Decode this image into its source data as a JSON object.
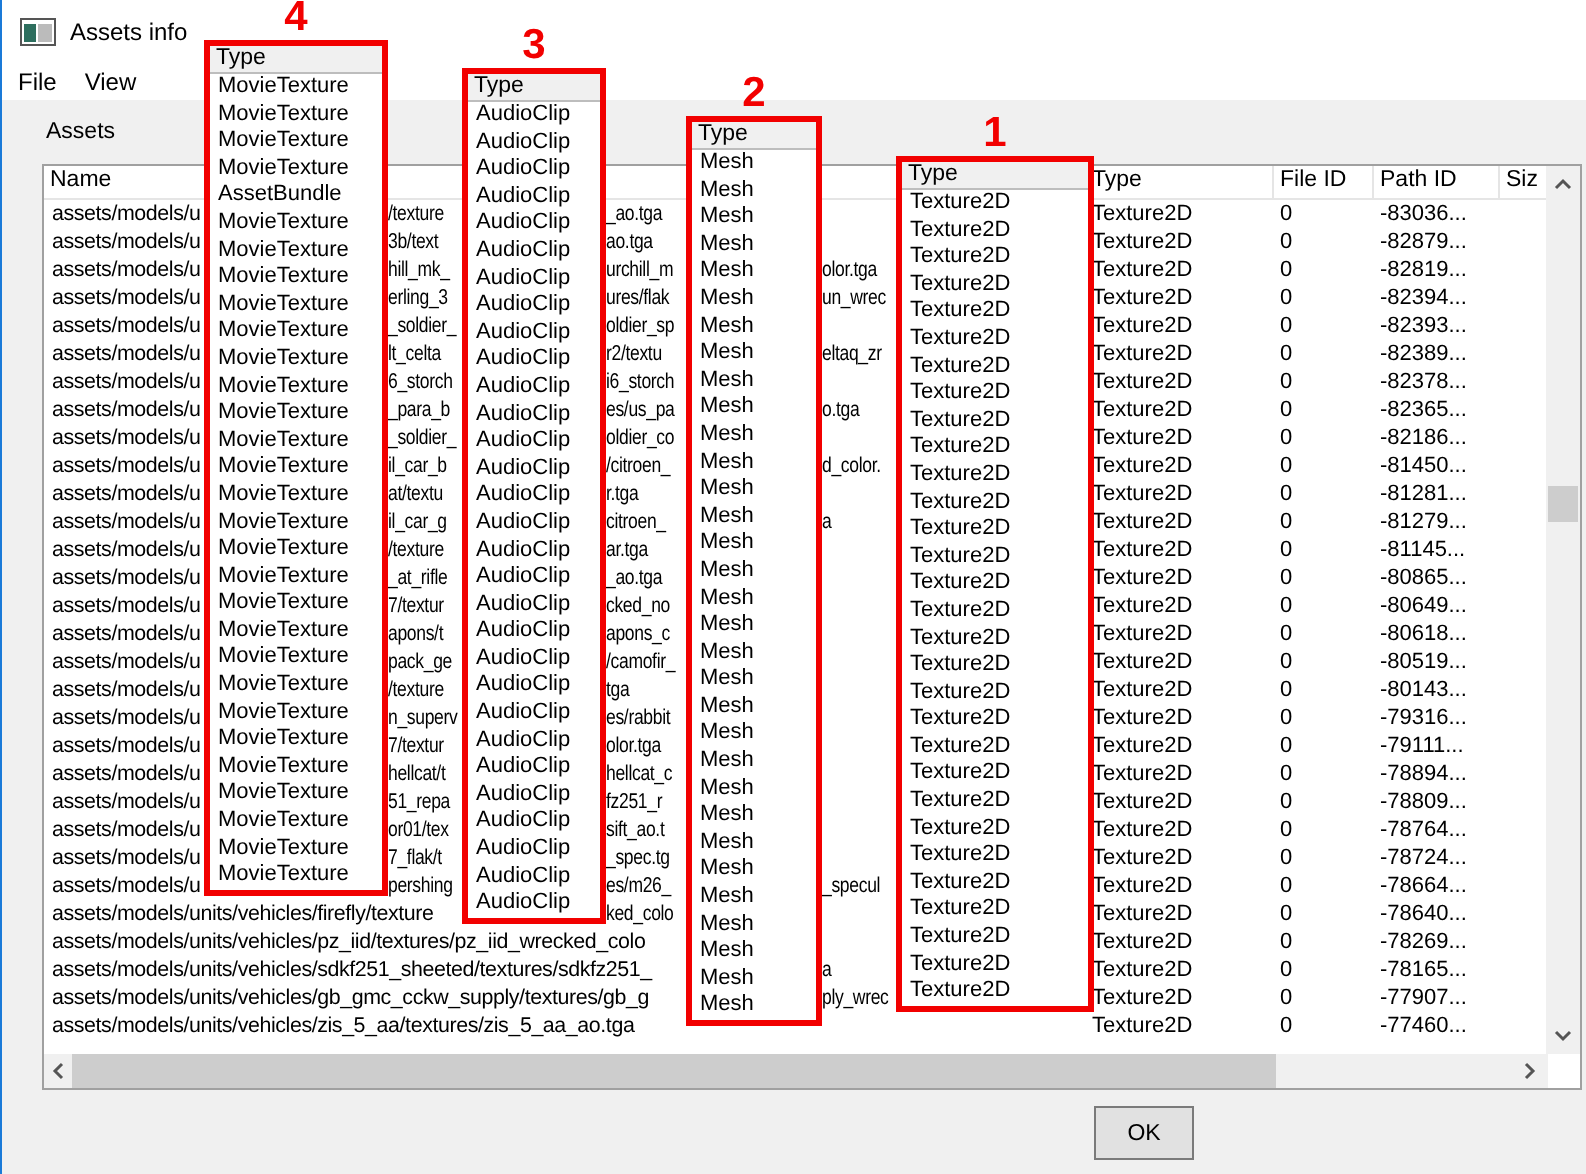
{
  "window": {
    "title": "Assets info"
  },
  "menu": [
    {
      "label": "File"
    },
    {
      "label": "View"
    }
  ],
  "group_label": "Assets",
  "table": {
    "columns": [
      "Name",
      "Type",
      "File ID",
      "Path ID",
      "Siz"
    ],
    "rows": [
      {
        "name": {
          "start": "assets/models/u",
          "gap_1": "/texture",
          "gap_2": "_ao.tga"
        },
        "type": "Texture2D",
        "file_id": "0",
        "path_id": "-83036..."
      },
      {
        "name": {
          "start": "assets/models/u",
          "gap_1": "3b/text",
          "gap_2": "ao.tga"
        },
        "type": "Texture2D",
        "file_id": "0",
        "path_id": "-82879..."
      },
      {
        "name": {
          "start": "assets/models/u",
          "gap_1": "hill_mk_",
          "gap_2": "urchill_m",
          "gap_3": "olor.tga"
        },
        "type": "Texture2D",
        "file_id": "0",
        "path_id": "-82819..."
      },
      {
        "name": {
          "start": "assets/models/u",
          "gap_1": "erling_3",
          "gap_2": "ures/flak",
          "gap_3": "un_wrec"
        },
        "type": "Texture2D",
        "file_id": "0",
        "path_id": "-82394..."
      },
      {
        "name": {
          "start": "assets/models/u",
          "gap_1": "_soldier_",
          "gap_2": "oldier_sp"
        },
        "type": "Texture2D",
        "file_id": "0",
        "path_id": "-82393..."
      },
      {
        "name": {
          "start": "assets/models/u",
          "gap_1": "lt_celta",
          "gap_2": "r2/textu",
          "gap_3": "eltaq_zr"
        },
        "type": "Texture2D",
        "file_id": "0",
        "path_id": "-82389..."
      },
      {
        "name": {
          "start": "assets/models/u",
          "gap_1": "6_storch",
          "gap_2": "i6_storch"
        },
        "type": "Texture2D",
        "file_id": "0",
        "path_id": "-82378..."
      },
      {
        "name": {
          "start": "assets/models/u",
          "gap_1": "_para_b",
          "gap_2": "es/us_pa",
          "gap_3": "o.tga"
        },
        "type": "Texture2D",
        "file_id": "0",
        "path_id": "-82365..."
      },
      {
        "name": {
          "start": "assets/models/u",
          "gap_1": "_soldier_",
          "gap_2": "oldier_co"
        },
        "type": "Texture2D",
        "file_id": "0",
        "path_id": "-82186..."
      },
      {
        "name": {
          "start": "assets/models/u",
          "gap_1": "il_car_b",
          "gap_2": "/citroen_",
          "gap_3": "d_color."
        },
        "type": "Texture2D",
        "file_id": "0",
        "path_id": "-81450..."
      },
      {
        "name": {
          "start": "assets/models/u",
          "gap_1": "at/textu",
          "gap_2": "r.tga"
        },
        "type": "Texture2D",
        "file_id": "0",
        "path_id": "-81281..."
      },
      {
        "name": {
          "start": "assets/models/u",
          "gap_1": "il_car_g",
          "gap_2": "citroen_",
          "gap_3": "a"
        },
        "type": "Texture2D",
        "file_id": "0",
        "path_id": "-81279..."
      },
      {
        "name": {
          "start": "assets/models/u",
          "gap_1": "/texture",
          "gap_2": "ar.tga"
        },
        "type": "Texture2D",
        "file_id": "0",
        "path_id": "-81145..."
      },
      {
        "name": {
          "start": "assets/models/u",
          "gap_1": "_at_rifle",
          "gap_2": "_ao.tga"
        },
        "type": "Texture2D",
        "file_id": "0",
        "path_id": "-80865..."
      },
      {
        "name": {
          "start": "assets/models/u",
          "gap_1": "7/textur",
          "gap_2": "cked_no"
        },
        "type": "Texture2D",
        "file_id": "0",
        "path_id": "-80649..."
      },
      {
        "name": {
          "start": "assets/models/u",
          "gap_1": "apons/t",
          "gap_2": "apons_c"
        },
        "type": "Texture2D",
        "file_id": "0",
        "path_id": "-80618..."
      },
      {
        "name": {
          "start": "assets/models/u",
          "gap_1": "pack_ge",
          "gap_2": "/camofir_"
        },
        "type": "Texture2D",
        "file_id": "0",
        "path_id": "-80519..."
      },
      {
        "name": {
          "start": "assets/models/u",
          "gap_1": "/texture",
          "gap_2": "tga"
        },
        "type": "Texture2D",
        "file_id": "0",
        "path_id": "-80143..."
      },
      {
        "name": {
          "start": "assets/models/u",
          "gap_1": "n_superv",
          "gap_2": "es/rabbit"
        },
        "type": "Texture2D",
        "file_id": "0",
        "path_id": "-79316..."
      },
      {
        "name": {
          "start": "assets/models/u",
          "gap_1": "7/textur",
          "gap_2": "olor.tga"
        },
        "type": "Texture2D",
        "file_id": "0",
        "path_id": "-79111..."
      },
      {
        "name": {
          "start": "assets/models/u",
          "gap_1": "hellcat/t",
          "gap_2": "hellcat_c"
        },
        "type": "Texture2D",
        "file_id": "0",
        "path_id": "-78894..."
      },
      {
        "name": {
          "start": "assets/models/u",
          "gap_1": "51_repa",
          "gap_2": "fz251_r"
        },
        "type": "Texture2D",
        "file_id": "0",
        "path_id": "-78809..."
      },
      {
        "name": {
          "start": "assets/models/u",
          "gap_1": "or01/tex",
          "gap_2": "sift_ao.t"
        },
        "type": "Texture2D",
        "file_id": "0",
        "path_id": "-78764..."
      },
      {
        "name": {
          "start": "assets/models/u",
          "gap_1": "7_flak/t",
          "gap_2": "_spec.tg"
        },
        "type": "Texture2D",
        "file_id": "0",
        "path_id": "-78724..."
      },
      {
        "name": {
          "start": "assets/models/u",
          "gap_1": "pershing",
          "gap_2": "es/m26_",
          "gap_3": "_specul"
        },
        "type": "Texture2D",
        "file_id": "0",
        "path_id": "-78664..."
      },
      {
        "name": {
          "start": "assets/models/units/vehicles/firefly/texture",
          "gap_2": "ked_colo"
        },
        "type": "Texture2D",
        "file_id": "0",
        "path_id": "-78640..."
      },
      {
        "name": {
          "start": "assets/models/units/vehicles/pz_iid/textures/pz_iid_wrecked_colo"
        },
        "type": "Texture2D",
        "file_id": "0",
        "path_id": "-78269..."
      },
      {
        "name": {
          "start": "assets/models/units/vehicles/sdkf251_sheeted/textures/sdkfz251_",
          "gap_3": "a"
        },
        "type": "Texture2D",
        "file_id": "0",
        "path_id": "-78165..."
      },
      {
        "name": {
          "start": "assets/models/units/vehicles/gb_gmc_cckw_supply/textures/gb_g",
          "gap_3": "ply_wrec"
        },
        "type": "Texture2D",
        "file_id": "0",
        "path_id": "-77907..."
      },
      {
        "name": {
          "start": "assets/models/units/vehicles/zis_5_aa/textures/zis_5_aa_ao.tga"
        },
        "type": "Texture2D",
        "file_id": "0",
        "path_id": "-77460..."
      }
    ]
  },
  "callouts": [
    {
      "number": "4",
      "header": "Type",
      "items": [
        "MovieTexture",
        "MovieTexture",
        "MovieTexture",
        "MovieTexture",
        "AssetBundle",
        "MovieTexture",
        "MovieTexture",
        "MovieTexture",
        "MovieTexture",
        "MovieTexture",
        "MovieTexture",
        "MovieTexture",
        "MovieTexture",
        "MovieTexture",
        "MovieTexture",
        "MovieTexture",
        "MovieTexture",
        "MovieTexture",
        "MovieTexture",
        "MovieTexture",
        "MovieTexture",
        "MovieTexture",
        "MovieTexture",
        "MovieTexture",
        "MovieTexture",
        "MovieTexture",
        "MovieTexture",
        "MovieTexture",
        "MovieTexture",
        "MovieTexture"
      ]
    },
    {
      "number": "3",
      "header": "Type",
      "items": [
        "AudioClip",
        "AudioClip",
        "AudioClip",
        "AudioClip",
        "AudioClip",
        "AudioClip",
        "AudioClip",
        "AudioClip",
        "AudioClip",
        "AudioClip",
        "AudioClip",
        "AudioClip",
        "AudioClip",
        "AudioClip",
        "AudioClip",
        "AudioClip",
        "AudioClip",
        "AudioClip",
        "AudioClip",
        "AudioClip",
        "AudioClip",
        "AudioClip",
        "AudioClip",
        "AudioClip",
        "AudioClip",
        "AudioClip",
        "AudioClip",
        "AudioClip",
        "AudioClip",
        "AudioClip"
      ]
    },
    {
      "number": "2",
      "header": "Type",
      "items": [
        "Mesh",
        "Mesh",
        "Mesh",
        "Mesh",
        "Mesh",
        "Mesh",
        "Mesh",
        "Mesh",
        "Mesh",
        "Mesh",
        "Mesh",
        "Mesh",
        "Mesh",
        "Mesh",
        "Mesh",
        "Mesh",
        "Mesh",
        "Mesh",
        "Mesh",
        "Mesh",
        "Mesh",
        "Mesh",
        "Mesh",
        "Mesh",
        "Mesh",
        "Mesh",
        "Mesh",
        "Mesh",
        "Mesh",
        "Mesh",
        "Mesh",
        "Mesh"
      ]
    },
    {
      "number": "1",
      "header": "Type",
      "items": [
        "Texture2D",
        "Texture2D",
        "Texture2D",
        "Texture2D",
        "Texture2D",
        "Texture2D",
        "Texture2D",
        "Texture2D",
        "Texture2D",
        "Texture2D",
        "Texture2D",
        "Texture2D",
        "Texture2D",
        "Texture2D",
        "Texture2D",
        "Texture2D",
        "Texture2D",
        "Texture2D",
        "Texture2D",
        "Texture2D",
        "Texture2D",
        "Texture2D",
        "Texture2D",
        "Texture2D",
        "Texture2D",
        "Texture2D",
        "Texture2D",
        "Texture2D",
        "Texture2D",
        "Texture2D"
      ]
    }
  ],
  "buttons": [
    {
      "label": "OK"
    }
  ]
}
